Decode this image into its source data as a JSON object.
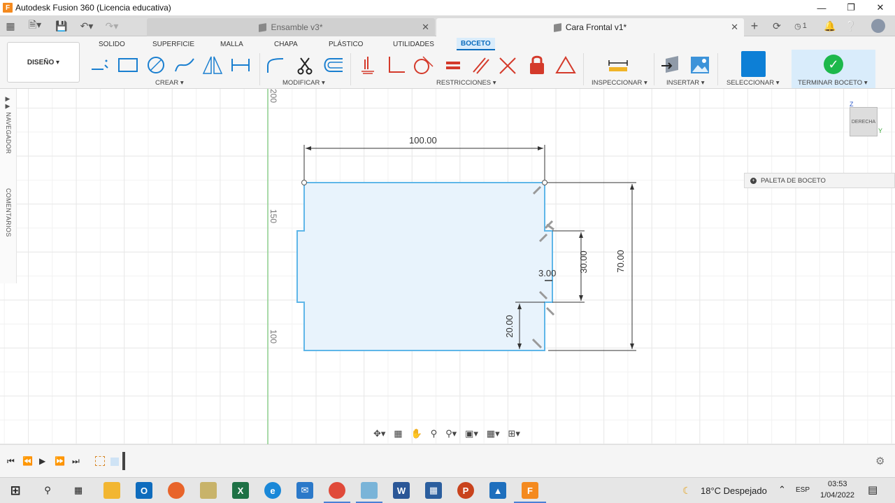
{
  "window": {
    "title": "Autodesk Fusion 360 (Licencia educativa)",
    "logo": "F"
  },
  "tabs": [
    {
      "label": "Ensamble v3*",
      "active": false
    },
    {
      "label": "Cara Frontal v1*",
      "active": true
    }
  ],
  "qa_badge": "1",
  "ribbon": {
    "design_label": "DISEÑO ▾",
    "tabs": [
      "SOLIDO",
      "SUPERFICIE",
      "MALLA",
      "CHAPA",
      "PLÁSTICO",
      "UTILIDADES",
      "BOCETO"
    ],
    "groups": {
      "crear": "CREAR ▾",
      "modificar": "MODIFICAR ▾",
      "restricciones": "RESTRICCIONES ▾",
      "inspeccionar": "INSPECCIONAR ▾",
      "insertar": "INSERTAR ▾",
      "seleccionar": "SELECCIONAR ▾",
      "terminar": "TERMINAR BOCETO ▾"
    }
  },
  "side": {
    "navigator": "NAVEGADOR",
    "comments": "COMENTARIOS"
  },
  "axis_labels": [
    "200",
    "150",
    "100"
  ],
  "dimensions": {
    "width": "100.00",
    "height": "70.00",
    "notch_height": "30.00",
    "notch_depth": "3.00",
    "bottom_offset": "20.00"
  },
  "palette": {
    "label": "PALETA DE BOCETO"
  },
  "viewcube": {
    "face": "DERECHA",
    "z": "Z",
    "y": "Y"
  },
  "taskbar": {
    "weather": "18°C  Despejado",
    "lang": "ESP",
    "time": "03:53",
    "date": "1/04/2022"
  },
  "colors": {
    "sketch_fill": "#e8f3fc",
    "sketch_line": "#5fb6e8",
    "accent": "#0d7fd6",
    "finish": "#1db84b"
  }
}
